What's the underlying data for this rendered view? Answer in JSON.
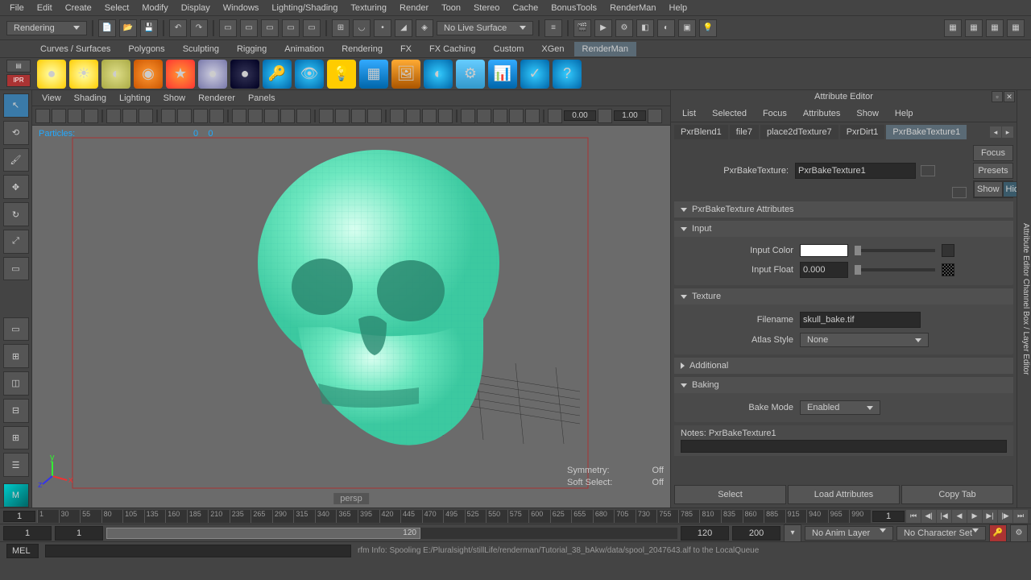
{
  "menubar": [
    "File",
    "Edit",
    "Create",
    "Select",
    "Modify",
    "Display",
    "Windows",
    "Lighting/Shading",
    "Texturing",
    "Render",
    "Toon",
    "Stereo",
    "Cache",
    "BonusTools",
    "RenderMan",
    "Help"
  ],
  "workspace": {
    "label": "Rendering"
  },
  "toolbar": {
    "nolivesurface": "No Live Surface"
  },
  "shelf_tabs": [
    "Curves / Surfaces",
    "Polygons",
    "Sculpting",
    "Rigging",
    "Animation",
    "Rendering",
    "FX",
    "FX Caching",
    "Custom",
    "XGen",
    "RenderMan"
  ],
  "shelf_tabs_selected": 10,
  "viewport_menu": [
    "View",
    "Shading",
    "Lighting",
    "Show",
    "Renderer",
    "Panels"
  ],
  "viewport": {
    "particles_label": "Particles:",
    "particles_val": "0",
    "particles_val2": "0",
    "val1": "0.00",
    "val2": "1.00",
    "symmetry_label": "Symmetry:",
    "symmetry_val": "Off",
    "softselect_label": "Soft Select:",
    "softselect_val": "Off",
    "camera": "persp"
  },
  "attr": {
    "title": "Attribute Editor",
    "menu": [
      "List",
      "Selected",
      "Focus",
      "Attributes",
      "Show",
      "Help"
    ],
    "tabs": [
      "PxrBlend1",
      "file7",
      "place2dTexture7",
      "PxrDirt1",
      "PxrBakeTexture1"
    ],
    "tabs_selected": 4,
    "node_label": "PxrBakeTexture:",
    "node_value": "PxrBakeTexture1",
    "side": {
      "focus": "Focus",
      "presets": "Presets",
      "show": "Show",
      "hide": "Hide"
    },
    "sections": {
      "attrs": "PxrBakeTexture Attributes",
      "input": "Input",
      "input_color": "Input Color",
      "input_float": "Input Float",
      "input_float_val": "0.000",
      "texture": "Texture",
      "filename": "Filename",
      "filename_val": "skull_bake.tif",
      "atlas": "Atlas Style",
      "atlas_val": "None",
      "additional": "Additional",
      "baking": "Baking",
      "bakemode": "Bake Mode",
      "bakemode_val": "Enabled"
    },
    "notes_label": "Notes: PxrBakeTexture1",
    "buttons": {
      "select": "Select",
      "load": "Load Attributes",
      "copy": "Copy Tab"
    }
  },
  "right_strip": "Attribute Editor   Channel Box / Layer Editor",
  "timeline": {
    "start": "1",
    "ticks": [
      "1",
      "30",
      "55",
      "80",
      "105",
      "135",
      "160",
      "185",
      "210",
      "235",
      "265",
      "290",
      "315",
      "340",
      "365",
      "395",
      "420",
      "445",
      "470",
      "495",
      "525",
      "550",
      "575",
      "600",
      "625",
      "655",
      "680",
      "705",
      "730",
      "755",
      "785",
      "810",
      "835",
      "860",
      "885",
      "915",
      "940",
      "965",
      "990"
    ],
    "cur": "1"
  },
  "range": {
    "min": "1",
    "start": "1",
    "end": "120",
    "max1": "120",
    "max2": "200",
    "animlayer": "No Anim Layer",
    "charset": "No Character Set"
  },
  "status": {
    "mel": "MEL",
    "msg": "rfm Info: Spooling E:/Pluralsight/stillLife/renderman/Tutorial_38_bAkw/data/spool_2047643.alf to the LocalQueue"
  }
}
